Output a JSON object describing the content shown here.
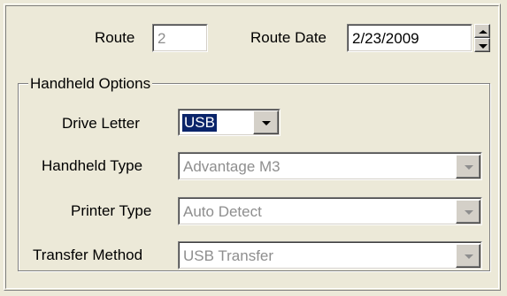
{
  "route": {
    "label": "Route",
    "value": "2"
  },
  "route_date": {
    "label": "Route Date",
    "value": "2/23/2009"
  },
  "handheld_options": {
    "legend": "Handheld Options",
    "drive_letter": {
      "label": "Drive Letter",
      "value": "USB",
      "enabled": true
    },
    "handheld_type": {
      "label": "Handheld Type",
      "value": "Advantage M3",
      "enabled": false
    },
    "printer_type": {
      "label": "Printer Type",
      "value": "Auto Detect",
      "enabled": false
    },
    "transfer_method": {
      "label": "Transfer Method",
      "value": "USB Transfer",
      "enabled": false
    }
  },
  "icons": {
    "dropdown": "chevron-down-icon",
    "spin_up": "spin-up-icon",
    "spin_down": "spin-down-icon"
  },
  "colors": {
    "background": "#ece9d8",
    "selection": "#0a246a",
    "disabled_text": "#8e8e8e"
  }
}
